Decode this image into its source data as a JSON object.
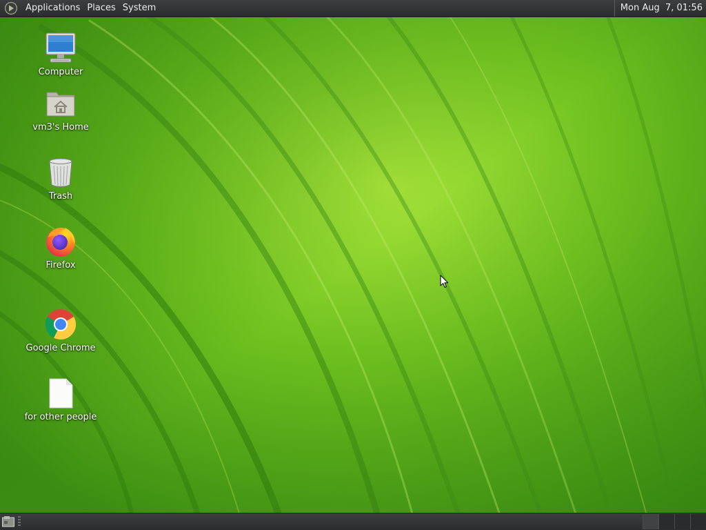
{
  "top_panel": {
    "menus": [
      {
        "label": "Applications"
      },
      {
        "label": "Places"
      },
      {
        "label": "System"
      }
    ],
    "clock": "Mon Aug  7, 01:56",
    "logo_icon": "distro-logo-icon"
  },
  "desktop": {
    "wallpaper": "green-leaf",
    "icons": [
      {
        "label": "Computer",
        "icon": "computer-icon"
      },
      {
        "label": "vm3's Home",
        "icon": "home-folder-icon"
      },
      {
        "label": "Trash",
        "icon": "trash-icon"
      },
      {
        "label": "Firefox",
        "icon": "firefox-icon"
      },
      {
        "label": "Google Chrome",
        "icon": "chrome-icon"
      },
      {
        "label": "for other people",
        "icon": "text-file-icon"
      }
    ]
  },
  "bottom_panel": {
    "show_desktop_icon": "show-desktop-icon",
    "workspaces": 4
  },
  "colors": {
    "panel_bg": "#2f3031",
    "panel_text": "#ececec",
    "wallpaper_base": "#5cb01c",
    "wallpaper_dark": "#2e7a0e",
    "wallpaper_light": "#a8e03a"
  }
}
